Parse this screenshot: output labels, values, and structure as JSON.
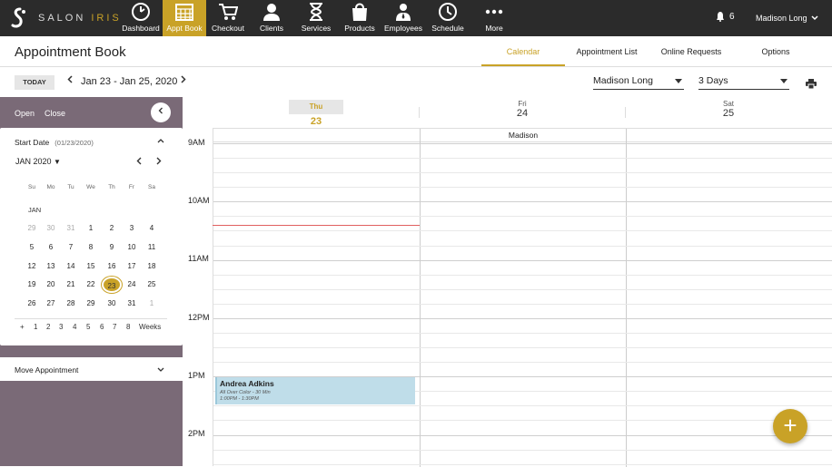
{
  "brand": {
    "name_left": "SALON",
    "name_right": "IRIS"
  },
  "nav": [
    {
      "label": "Dashboard",
      "icon": "gauge-icon"
    },
    {
      "label": "Appt Book",
      "icon": "calendar-grid-icon"
    },
    {
      "label": "Checkout",
      "icon": "cart-icon"
    },
    {
      "label": "Clients",
      "icon": "people-icon"
    },
    {
      "label": "Services",
      "icon": "hourglass-icon"
    },
    {
      "label": "Products",
      "icon": "bag-icon"
    },
    {
      "label": "Employees",
      "icon": "employee-icon"
    },
    {
      "label": "Schedule",
      "icon": "clock-icon"
    },
    {
      "label": "More",
      "icon": "dots-icon"
    }
  ],
  "notifications": {
    "count": "6"
  },
  "user": {
    "name": "Madison Long"
  },
  "header": {
    "title": "Appointment Book",
    "tabs": [
      "Calendar",
      "Appointment List",
      "Online Requests",
      "Options"
    ]
  },
  "toolbar": {
    "today": "TODAY",
    "range": "Jan 23 - Jan 25, 2020",
    "employee": "Madison Long",
    "view": "3 Days"
  },
  "sidebar": {
    "open": "Open",
    "close": "Close",
    "start_date_label": "Start Date",
    "start_date_value": "(01/23/2020)",
    "month": "JAN 2020",
    "month_short": "JAN",
    "dow": [
      "Su",
      "Mo",
      "Tu",
      "We",
      "Th",
      "Fr",
      "Sa"
    ],
    "weeks": [
      [
        "29",
        "30",
        "31",
        "1",
        "2",
        "3",
        "4"
      ],
      [
        "5",
        "6",
        "7",
        "8",
        "9",
        "10",
        "11"
      ],
      [
        "12",
        "13",
        "14",
        "15",
        "16",
        "17",
        "18"
      ],
      [
        "19",
        "20",
        "21",
        "22",
        "23",
        "24",
        "25"
      ],
      [
        "26",
        "27",
        "28",
        "29",
        "30",
        "31",
        "1"
      ]
    ],
    "week_options": [
      "+",
      "1",
      "2",
      "3",
      "4",
      "5",
      "6",
      "7",
      "8",
      "Weeks"
    ],
    "move": "Move Appointment"
  },
  "columns": [
    {
      "dow": "Thu",
      "day": "23"
    },
    {
      "dow": "Fri",
      "day": "24"
    },
    {
      "dow": "Sat",
      "day": "25"
    }
  ],
  "resource": "Madison",
  "times": [
    "9AM",
    "10AM",
    "11AM",
    "12PM",
    "1PM",
    "2PM"
  ],
  "appointment": {
    "client": "Andrea Adkins",
    "service": "All Over Color - 30 Min",
    "time": "1:00PM - 1:30PM"
  },
  "fab": "+"
}
